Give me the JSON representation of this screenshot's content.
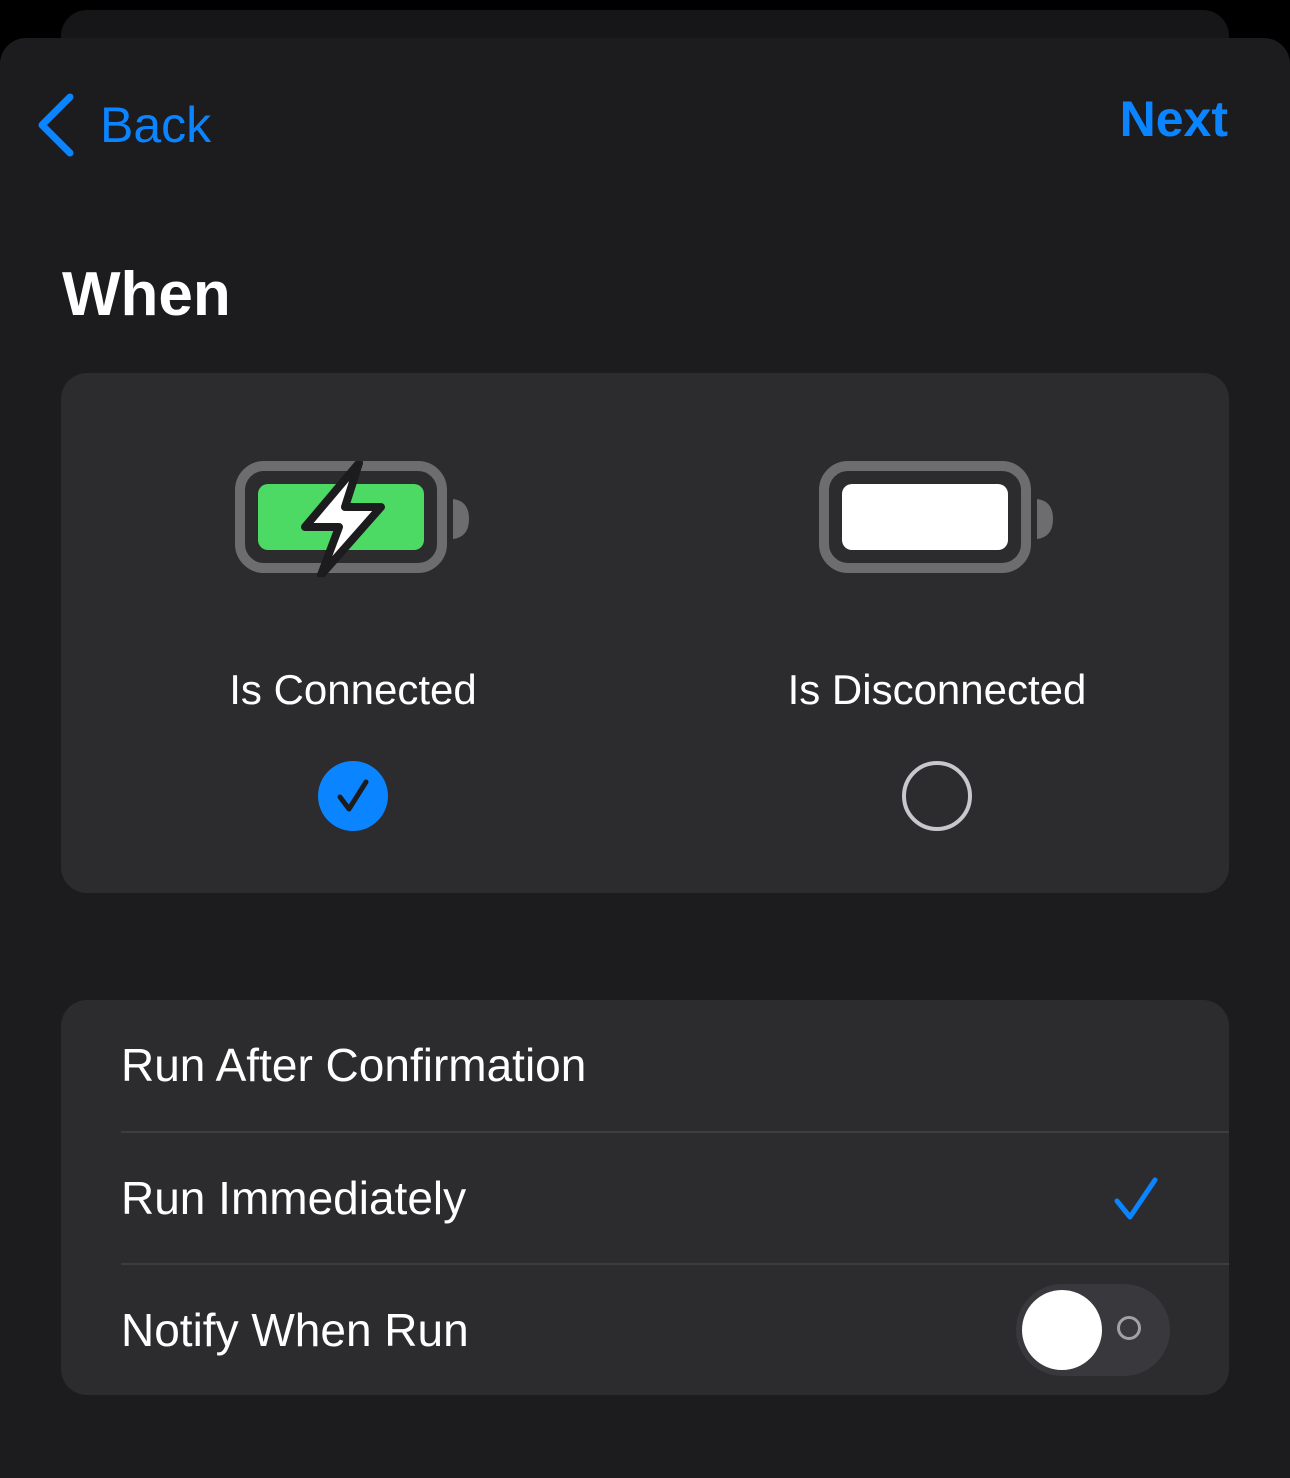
{
  "nav": {
    "back_label": "Back",
    "next_label": "Next"
  },
  "section": {
    "title": "When"
  },
  "choices": [
    {
      "label": "Is Connected",
      "icon": "battery-charging-icon",
      "selected": true
    },
    {
      "label": "Is Disconnected",
      "icon": "battery-full-icon",
      "selected": false
    }
  ],
  "options": [
    {
      "label": "Run After Confirmation",
      "selected": false
    },
    {
      "label": "Run Immediately",
      "selected": true
    },
    {
      "label": "Notify When Run",
      "toggle_on": false
    }
  ],
  "colors": {
    "accent": "#0a84ff",
    "charge_green": "#4cd964",
    "sheet_background": "#1c1c1e",
    "card_background": "#2c2c2e"
  }
}
